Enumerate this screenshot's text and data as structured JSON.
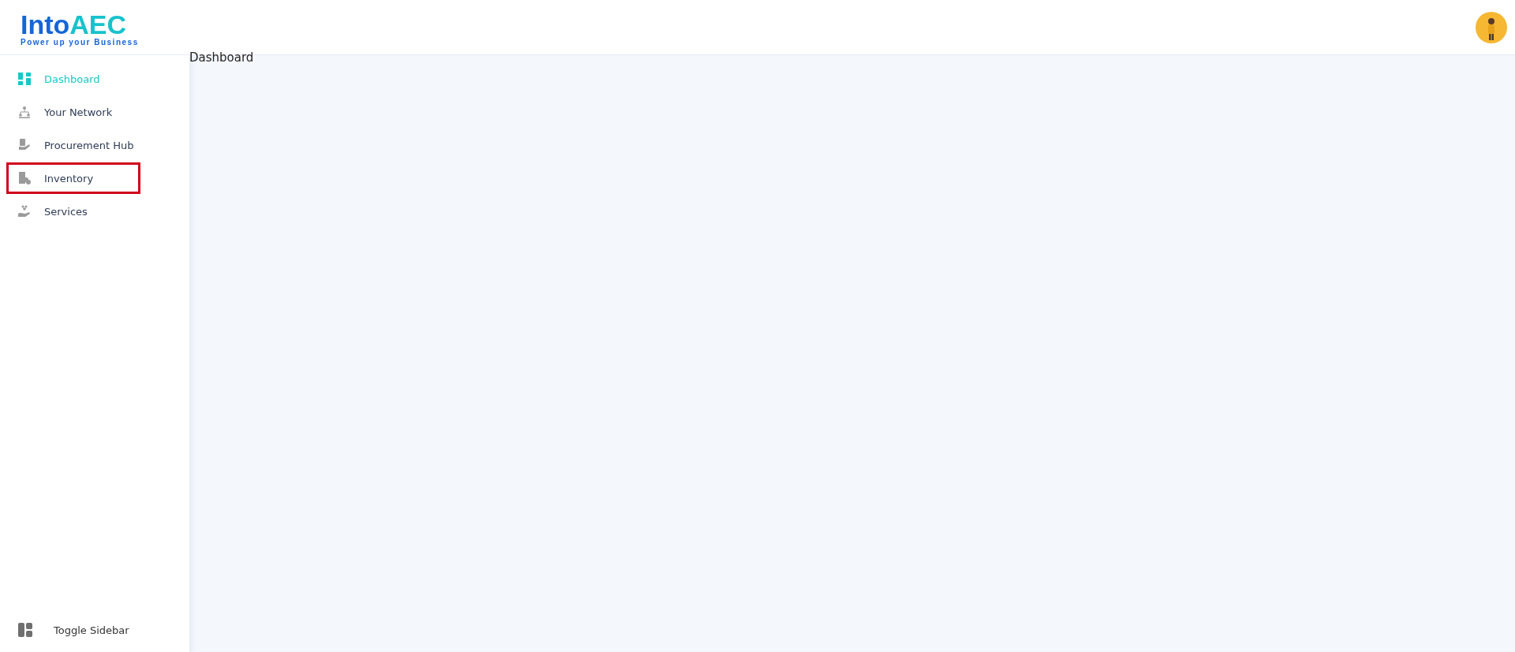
{
  "logo": {
    "name_part_1": "Into",
    "name_part_2": "AEC",
    "tagline": "Power up your Business"
  },
  "sidebar": {
    "items": [
      {
        "label": "Dashboard",
        "selected": true,
        "highlighted": false
      },
      {
        "label": "Your Network",
        "selected": false,
        "highlighted": false
      },
      {
        "label": "Procurement Hub",
        "selected": false,
        "highlighted": false
      },
      {
        "label": "Inventory",
        "selected": false,
        "highlighted": true
      },
      {
        "label": "Services",
        "selected": false,
        "highlighted": false
      }
    ],
    "toggle": {
      "label": "Toggle Sidebar"
    }
  },
  "page": {
    "title": "Dashboard"
  }
}
